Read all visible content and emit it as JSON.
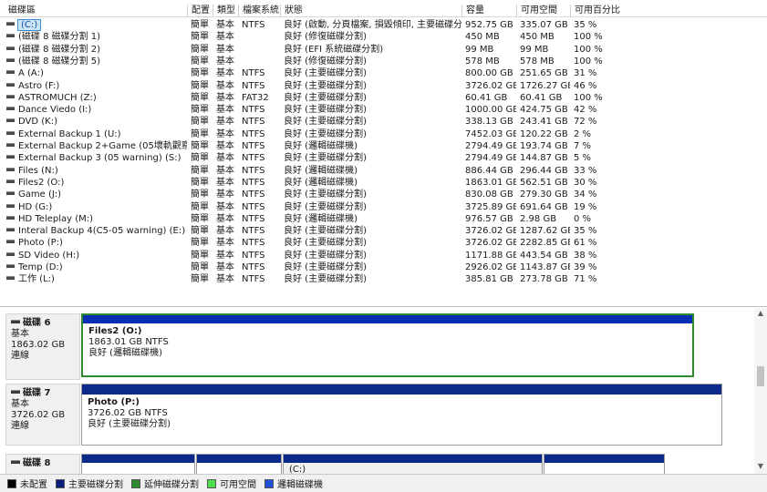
{
  "columns": [
    "磁碟區",
    "配置",
    "類型",
    "檔案系統",
    "狀態",
    "容量",
    "可用空間",
    "可用百分比"
  ],
  "volumes": [
    {
      "name": "(C:)",
      "layout": "簡單",
      "type": "基本",
      "fs": "NTFS",
      "status": "良好 (啟動, 分頁檔案, 損毀傾印, 主要磁碟分割)",
      "capacity": "952.75 GB",
      "free": "335.07 GB",
      "pct": "35 %"
    },
    {
      "name": "(磁碟 8 磁碟分割 1)",
      "layout": "簡單",
      "type": "基本",
      "fs": "",
      "status": "良好 (修復磁碟分割)",
      "capacity": "450 MB",
      "free": "450 MB",
      "pct": "100 %"
    },
    {
      "name": "(磁碟 8 磁碟分割 2)",
      "layout": "簡單",
      "type": "基本",
      "fs": "",
      "status": "良好 (EFI 系統磁碟分割)",
      "capacity": "99 MB",
      "free": "99 MB",
      "pct": "100 %"
    },
    {
      "name": "(磁碟 8 磁碟分割 5)",
      "layout": "簡單",
      "type": "基本",
      "fs": "",
      "status": "良好 (修復磁碟分割)",
      "capacity": "578 MB",
      "free": "578 MB",
      "pct": "100 %"
    },
    {
      "name": "A (A:)",
      "layout": "簡單",
      "type": "基本",
      "fs": "NTFS",
      "status": "良好 (主要磁碟分割)",
      "capacity": "800.00 GB",
      "free": "251.65 GB",
      "pct": "31 %"
    },
    {
      "name": "Astro (F:)",
      "layout": "簡單",
      "type": "基本",
      "fs": "NTFS",
      "status": "良好 (主要磁碟分割)",
      "capacity": "3726.02 GB",
      "free": "1726.27 GB",
      "pct": "46 %"
    },
    {
      "name": "ASTROMUCH (Z:)",
      "layout": "簡單",
      "type": "基本",
      "fs": "FAT32",
      "status": "良好 (主要磁碟分割)",
      "capacity": "60.41 GB",
      "free": "60.41 GB",
      "pct": "100 %"
    },
    {
      "name": "Dance Viedo (I:)",
      "layout": "簡單",
      "type": "基本",
      "fs": "NTFS",
      "status": "良好 (主要磁碟分割)",
      "capacity": "1000.00 GB",
      "free": "424.75 GB",
      "pct": "42 %"
    },
    {
      "name": "DVD (K:)",
      "layout": "簡單",
      "type": "基本",
      "fs": "NTFS",
      "status": "良好 (主要磁碟分割)",
      "capacity": "338.13 GB",
      "free": "243.41 GB",
      "pct": "72 %"
    },
    {
      "name": "External Backup 1 (U:)",
      "layout": "簡單",
      "type": "基本",
      "fs": "NTFS",
      "status": "良好 (主要磁碟分割)",
      "capacity": "7452.03 GB",
      "free": "120.22 GB",
      "pct": "2 %"
    },
    {
      "name": "External Backup 2+Game (05壞軌觀察) (R:)",
      "layout": "簡單",
      "type": "基本",
      "fs": "NTFS",
      "status": "良好 (邏輯磁碟機)",
      "capacity": "2794.49 GB",
      "free": "193.74 GB",
      "pct": "7 %"
    },
    {
      "name": "External Backup 3 (05 warning) (S:)",
      "layout": "簡單",
      "type": "基本",
      "fs": "NTFS",
      "status": "良好 (主要磁碟分割)",
      "capacity": "2794.49 GB",
      "free": "144.87 GB",
      "pct": "5 %"
    },
    {
      "name": "Files (N:)",
      "layout": "簡單",
      "type": "基本",
      "fs": "NTFS",
      "status": "良好 (邏輯磁碟機)",
      "capacity": "886.44 GB",
      "free": "296.44 GB",
      "pct": "33 %"
    },
    {
      "name": "Files2 (O:)",
      "layout": "簡單",
      "type": "基本",
      "fs": "NTFS",
      "status": "良好 (邏輯磁碟機)",
      "capacity": "1863.01 GB",
      "free": "562.51 GB",
      "pct": "30 %"
    },
    {
      "name": "Game (J:)",
      "layout": "簡單",
      "type": "基本",
      "fs": "NTFS",
      "status": "良好 (主要磁碟分割)",
      "capacity": "830.08 GB",
      "free": "279.30 GB",
      "pct": "34 %"
    },
    {
      "name": "HD (G:)",
      "layout": "簡單",
      "type": "基本",
      "fs": "NTFS",
      "status": "良好 (主要磁碟分割)",
      "capacity": "3725.89 GB",
      "free": "691.64 GB",
      "pct": "19 %"
    },
    {
      "name": "HD Teleplay (M:)",
      "layout": "簡單",
      "type": "基本",
      "fs": "NTFS",
      "status": "良好 (邏輯磁碟機)",
      "capacity": "976.57 GB",
      "free": "2.98 GB",
      "pct": "0 %"
    },
    {
      "name": "Interal Backup 4(C5-05 warning) (E:)",
      "layout": "簡單",
      "type": "基本",
      "fs": "NTFS",
      "status": "良好 (主要磁碟分割)",
      "capacity": "3726.02 GB",
      "free": "1287.62 GB",
      "pct": "35 %"
    },
    {
      "name": "Photo (P:)",
      "layout": "簡單",
      "type": "基本",
      "fs": "NTFS",
      "status": "良好 (主要磁碟分割)",
      "capacity": "3726.02 GB",
      "free": "2282.85 GB",
      "pct": "61 %"
    },
    {
      "name": "SD Video (H:)",
      "layout": "簡單",
      "type": "基本",
      "fs": "NTFS",
      "status": "良好 (主要磁碟分割)",
      "capacity": "1171.88 GB",
      "free": "443.54 GB",
      "pct": "38 %"
    },
    {
      "name": "Temp (D:)",
      "layout": "簡單",
      "type": "基本",
      "fs": "NTFS",
      "status": "良好 (主要磁碟分割)",
      "capacity": "2926.02 GB",
      "free": "1143.87 GB",
      "pct": "39 %"
    },
    {
      "name": "工作 (L:)",
      "layout": "簡單",
      "type": "基本",
      "fs": "NTFS",
      "status": "良好 (主要磁碟分割)",
      "capacity": "385.81 GB",
      "free": "273.78 GB",
      "pct": "71 %"
    }
  ],
  "disks": [
    {
      "name": "磁碟 6",
      "type": "基本",
      "size": "1863.02 GB",
      "state": "連線",
      "partitions": [
        {
          "name": "Files2  (O:)",
          "size": "1863.01 GB NTFS",
          "status": "良好 (邏輯磁碟機)"
        }
      ]
    },
    {
      "name": "磁碟 7",
      "type": "基本",
      "size": "3726.02 GB",
      "state": "連線",
      "partitions": [
        {
          "name": "Photo  (P:)",
          "size": "3726.02 GB NTFS",
          "status": "良好 (主要磁碟分割)"
        }
      ]
    },
    {
      "name": "磁碟 8",
      "type": "",
      "size": "",
      "state": "",
      "partitions": [
        {
          "name": ""
        },
        {
          "name": ""
        },
        {
          "name": "(C:)"
        },
        {
          "name": ""
        }
      ]
    }
  ],
  "legend": [
    {
      "label": "未配置",
      "color": "#000000"
    },
    {
      "label": "主要磁碟分割",
      "color": "#0b1f7a"
    },
    {
      "label": "延伸磁碟分割",
      "color": "#2e8b2e"
    },
    {
      "label": "可用空間",
      "color": "#4ce04c"
    },
    {
      "label": "邏輯磁碟機",
      "color": "#1f4fd6"
    }
  ],
  "colors": {
    "primary_bar": "#0b2a8a",
    "selected_border": "#2e8b2e"
  }
}
